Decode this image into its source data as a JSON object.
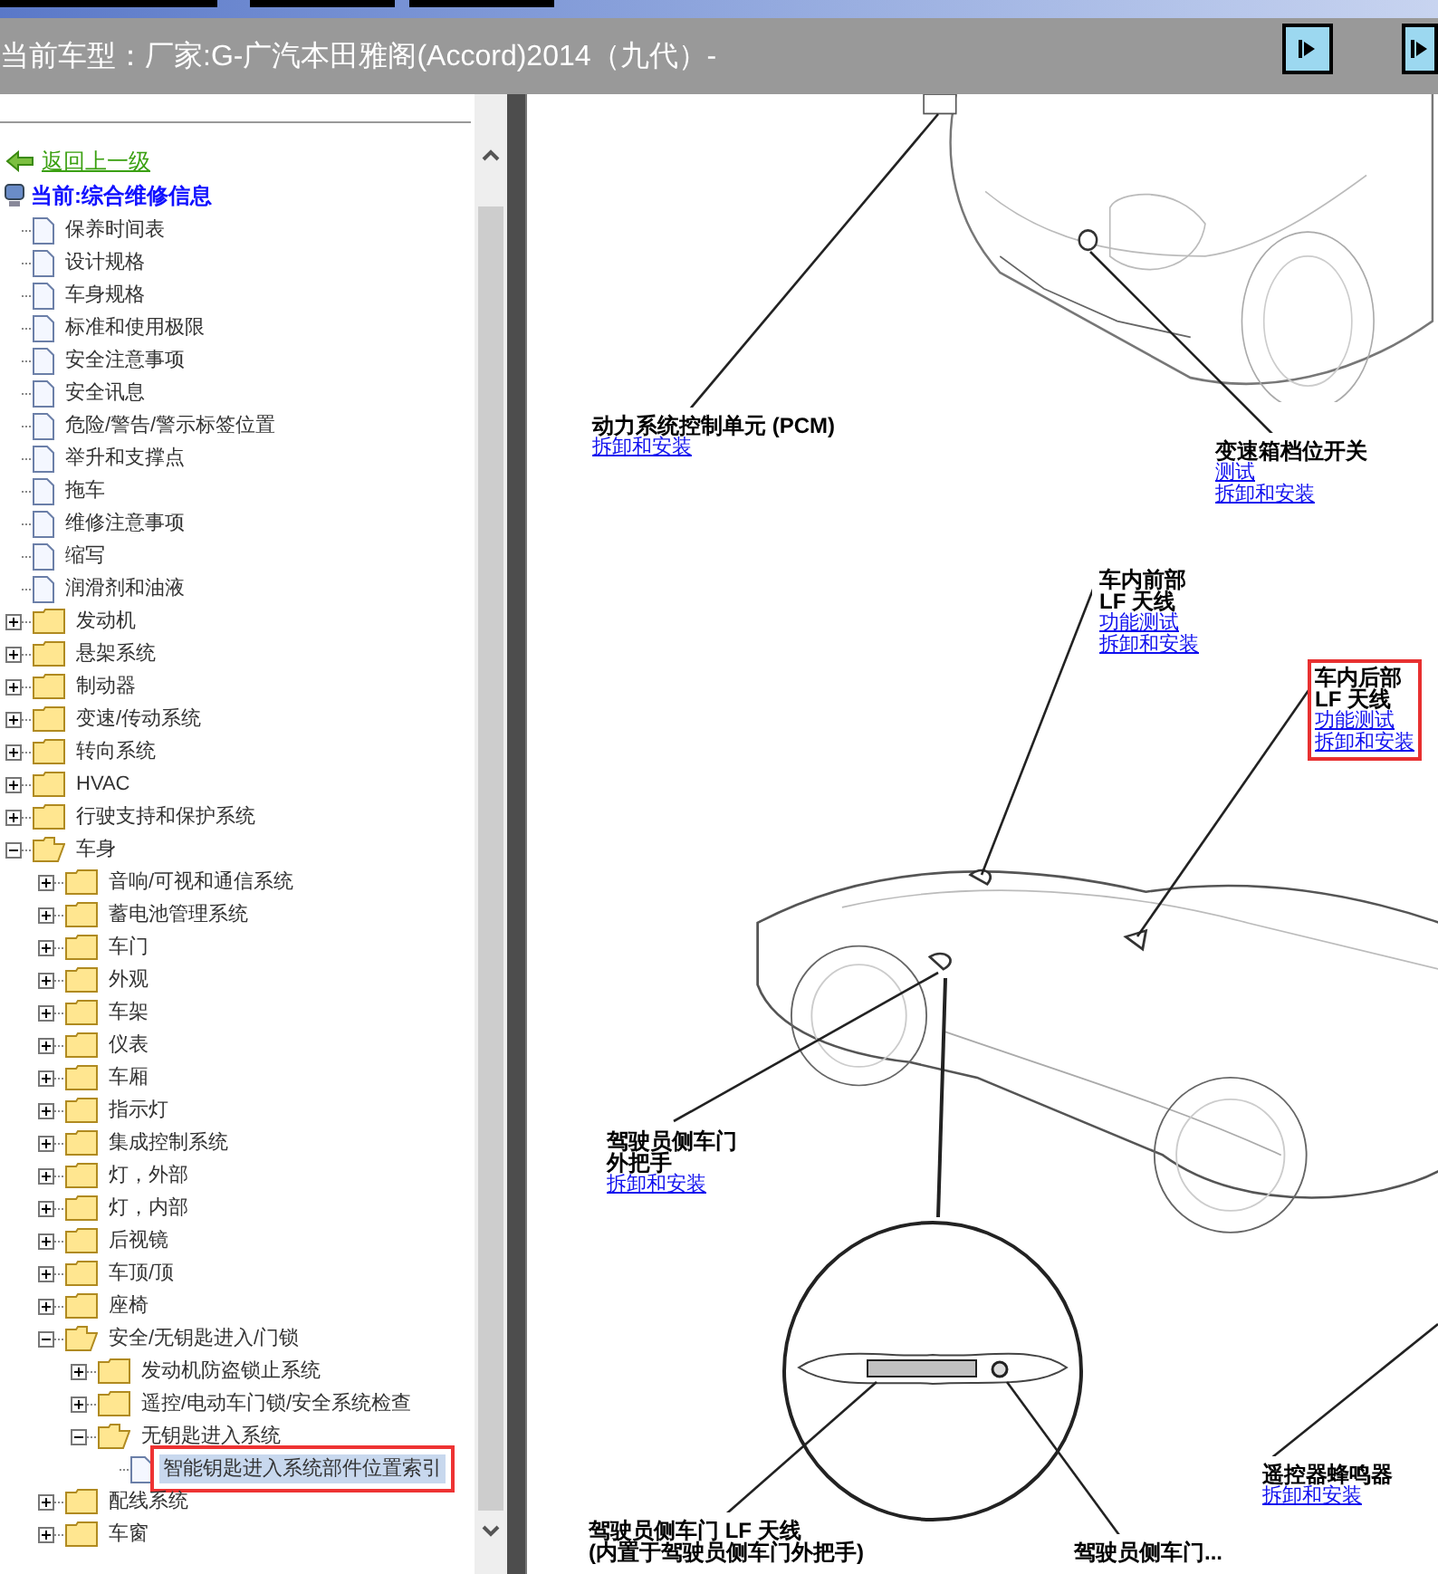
{
  "header": {
    "title": "当前车型：厂家:G-广汽本田雅阁(Accord)2014（九代）-"
  },
  "tree": {
    "back_link": "返回上一级",
    "current": "当前:综合维修信息",
    "items": [
      {
        "kind": "doc",
        "label": "保养时间表",
        "selected": false
      },
      {
        "kind": "doc",
        "label": "设计规格",
        "selected": false
      },
      {
        "kind": "doc",
        "label": "车身规格",
        "selected": false
      },
      {
        "kind": "doc",
        "label": "标准和使用极限",
        "selected": false
      },
      {
        "kind": "doc",
        "label": "安全注意事项",
        "selected": false
      },
      {
        "kind": "doc",
        "label": "安全讯息",
        "selected": false
      },
      {
        "kind": "doc",
        "label": "危险/警告/警示标签位置",
        "selected": false
      },
      {
        "kind": "doc",
        "label": "举升和支撑点",
        "selected": false
      },
      {
        "kind": "doc",
        "label": "拖车",
        "selected": false
      },
      {
        "kind": "doc",
        "label": "维修注意事项",
        "selected": false
      },
      {
        "kind": "doc",
        "label": "缩写",
        "selected": false
      },
      {
        "kind": "doc",
        "label": "润滑剂和油液",
        "selected": false
      },
      {
        "kind": "folder",
        "label": "发动机",
        "expanded": false,
        "selected": false
      },
      {
        "kind": "folder",
        "label": "悬架系统",
        "expanded": false,
        "selected": false
      },
      {
        "kind": "folder",
        "label": "制动器",
        "expanded": false,
        "selected": false
      },
      {
        "kind": "folder",
        "label": "变速/传动系统",
        "expanded": false,
        "selected": false
      },
      {
        "kind": "folder",
        "label": "转向系统",
        "expanded": false,
        "selected": false
      },
      {
        "kind": "folder",
        "label": "HVAC",
        "expanded": false,
        "selected": false
      },
      {
        "kind": "folder",
        "label": "行驶支持和保护系统",
        "expanded": false,
        "selected": false
      },
      {
        "kind": "folder",
        "label": "车身",
        "expanded": true,
        "selected": false,
        "children": [
          {
            "kind": "folder",
            "label": "音响/可视和通信系统",
            "expanded": false,
            "selected": false
          },
          {
            "kind": "folder",
            "label": "蓄电池管理系统",
            "expanded": false,
            "selected": false
          },
          {
            "kind": "folder",
            "label": "车门",
            "expanded": false,
            "selected": false
          },
          {
            "kind": "folder",
            "label": "外观",
            "expanded": false,
            "selected": false
          },
          {
            "kind": "folder",
            "label": "车架",
            "expanded": false,
            "selected": false
          },
          {
            "kind": "folder",
            "label": "仪表",
            "expanded": false,
            "selected": false
          },
          {
            "kind": "folder",
            "label": "车厢",
            "expanded": false,
            "selected": false
          },
          {
            "kind": "folder",
            "label": "指示灯",
            "expanded": false,
            "selected": false
          },
          {
            "kind": "folder",
            "label": "集成控制系统",
            "expanded": false,
            "selected": false
          },
          {
            "kind": "folder",
            "label": "灯，外部",
            "expanded": false,
            "selected": false
          },
          {
            "kind": "folder",
            "label": "灯，内部",
            "expanded": false,
            "selected": false
          },
          {
            "kind": "folder",
            "label": "后视镜",
            "expanded": false,
            "selected": false
          },
          {
            "kind": "folder",
            "label": "车顶/顶",
            "expanded": false,
            "selected": false
          },
          {
            "kind": "folder",
            "label": "座椅",
            "expanded": false,
            "selected": false
          },
          {
            "kind": "folder",
            "label": "安全/无钥匙进入/门锁",
            "expanded": true,
            "selected": false,
            "children": [
              {
                "kind": "folder",
                "label": "发动机防盗锁止系统",
                "expanded": false,
                "selected": false
              },
              {
                "kind": "folder",
                "label": "遥控/电动车门锁/安全系统检查",
                "expanded": false,
                "selected": false
              },
              {
                "kind": "folder",
                "label": "无钥匙进入系统",
                "expanded": true,
                "selected": false,
                "children": [
                  {
                    "kind": "doc",
                    "label": "智能钥匙进入系统部件位置索引",
                    "selected": true
                  }
                ]
              }
            ]
          },
          {
            "kind": "folder",
            "label": "配线系统",
            "expanded": false,
            "selected": false
          },
          {
            "kind": "folder",
            "label": "车窗",
            "expanded": false,
            "selected": false
          }
        ]
      }
    ]
  },
  "diagram": {
    "callouts": [
      {
        "lines": [
          "动力系统控制单元 (PCM)"
        ],
        "links": [
          "拆卸和安装"
        ],
        "highlighted": false
      },
      {
        "lines": [
          "变速箱档位开关"
        ],
        "links": [
          "测试",
          "拆卸和安装"
        ],
        "highlighted": false
      },
      {
        "lines": [
          "车内前部",
          "LF 天线"
        ],
        "links": [
          "功能测试",
          "拆卸和安装"
        ],
        "highlighted": false
      },
      {
        "lines": [
          "车内后部",
          "LF 天线"
        ],
        "links": [
          "功能测试",
          "拆卸和安装"
        ],
        "highlighted": true
      },
      {
        "lines": [
          "驾驶员侧车门",
          "外把手"
        ],
        "links": [
          "拆卸和安装"
        ],
        "highlighted": false
      },
      {
        "lines": [
          "遥控器蜂鸣器"
        ],
        "links": [
          "拆卸和安装"
        ],
        "highlighted": false
      },
      {
        "lines": [
          "驾驶员侧车门 LF 天线",
          "(内置于驾驶员侧车门外把手)"
        ],
        "highlighted": false
      },
      {
        "lines": [
          "驾驶员侧车门..."
        ],
        "highlighted": false
      }
    ]
  }
}
